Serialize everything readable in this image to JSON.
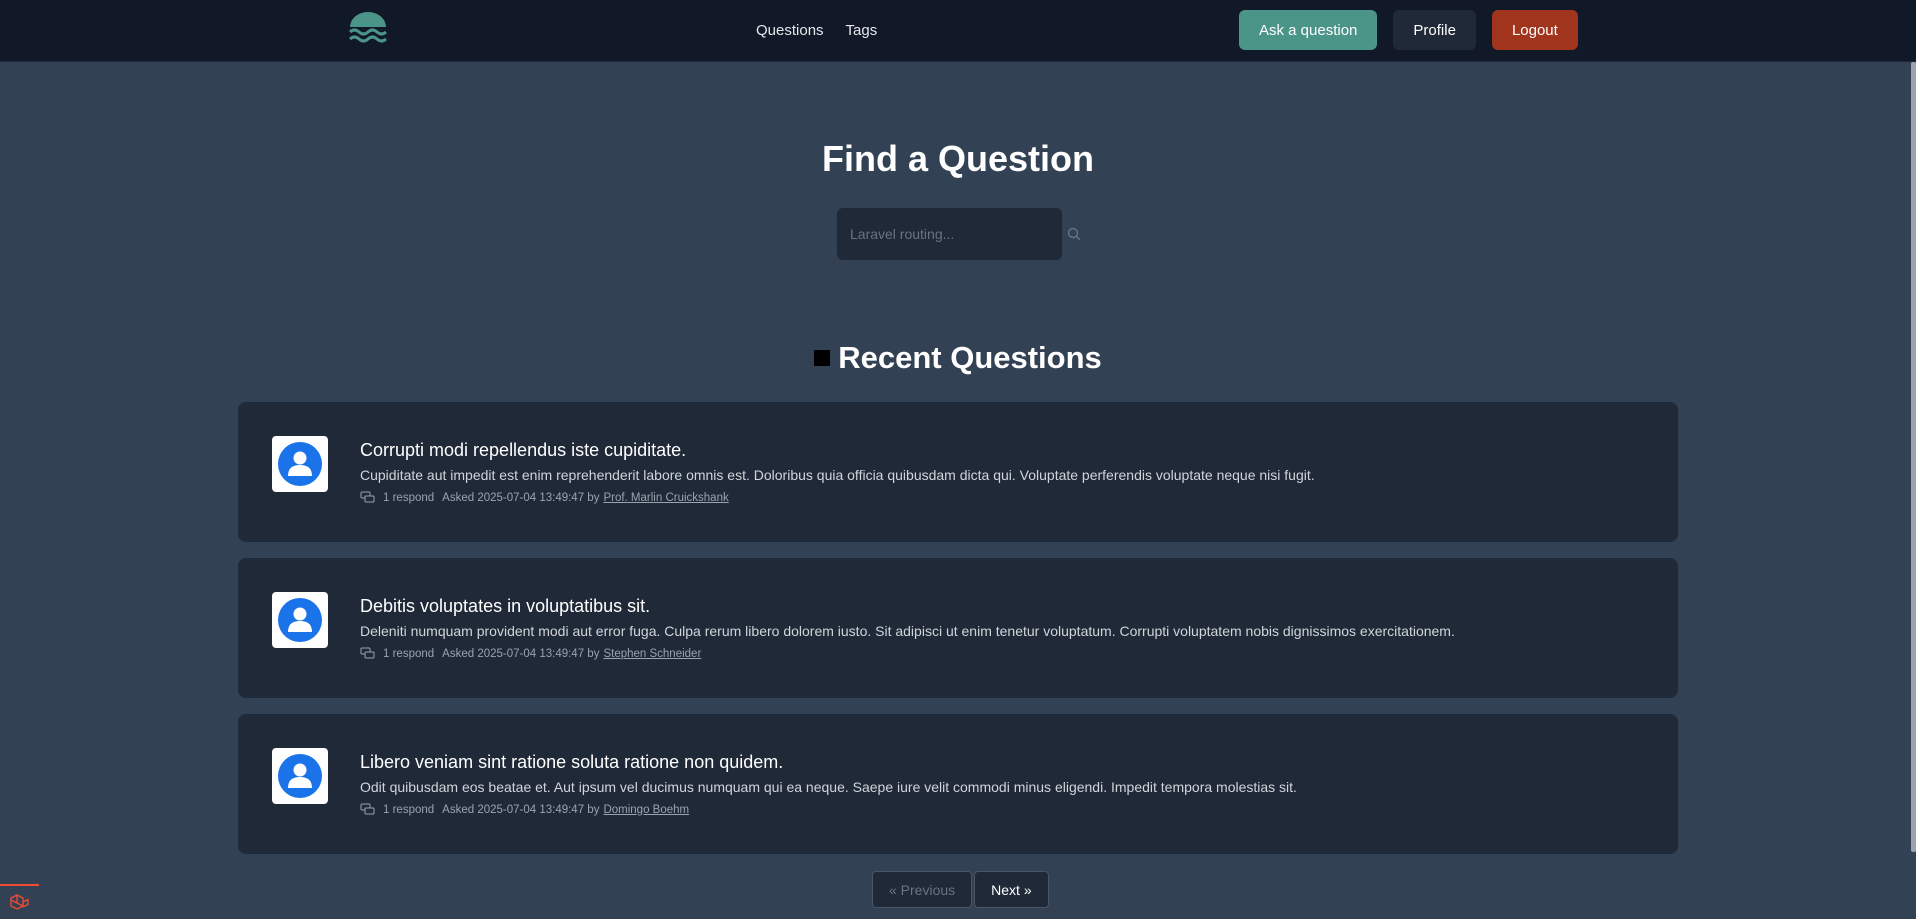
{
  "nav": {
    "links": [
      "Questions",
      "Tags"
    ],
    "ask_label": "Ask a question",
    "profile_label": "Profile",
    "logout_label": "Logout"
  },
  "hero": {
    "title": "Find a Question",
    "search_placeholder": "Laravel routing..."
  },
  "recent": {
    "title": "Recent Questions",
    "questions": [
      {
        "title": "Corrupti modi repellendus iste cupiditate.",
        "excerpt": "Cupiditate aut impedit est enim reprehenderit labore omnis est. Doloribus quia officia quibusdam dicta qui. Voluptate perferendis voluptate neque nisi fugit.",
        "responds": "1 respond",
        "asked": "Asked 2025-07-04 13:49:47 by",
        "author": "Prof. Marlin Cruickshank"
      },
      {
        "title": "Debitis voluptates in voluptatibus sit.",
        "excerpt": "Deleniti numquam provident modi aut error fuga. Culpa rerum libero dolorem iusto. Sit adipisci ut enim tenetur voluptatum. Corrupti voluptatem nobis dignissimos exercitationem.",
        "responds": "1 respond",
        "asked": "Asked 2025-07-04 13:49:47 by",
        "author": "Stephen Schneider"
      },
      {
        "title": "Libero veniam sint ratione soluta ratione non quidem.",
        "excerpt": "Odit quibusdam eos beatae et. Aut ipsum vel ducimus numquam qui ea neque. Saepe iure velit commodi minus eligendi. Impedit tempora molestias sit.",
        "responds": "1 respond",
        "asked": "Asked 2025-07-04 13:49:47 by",
        "author": "Domingo Boehm"
      }
    ]
  },
  "pagination": {
    "previous": "« Previous",
    "next": "Next »"
  },
  "colors": {
    "page_bg": "#334155",
    "nav_bg": "#111827",
    "card_bg": "#1f2937",
    "ask_button": "#4a9488",
    "logout_button": "#a1341c",
    "logo": "#4a9488"
  },
  "icons": {
    "logo": "waves-logo-icon",
    "search": "search-icon",
    "section": "square-icon",
    "avatar": "user-avatar-icon",
    "responds": "chat-bubbles-icon",
    "debugbar": "laravel-icon"
  }
}
